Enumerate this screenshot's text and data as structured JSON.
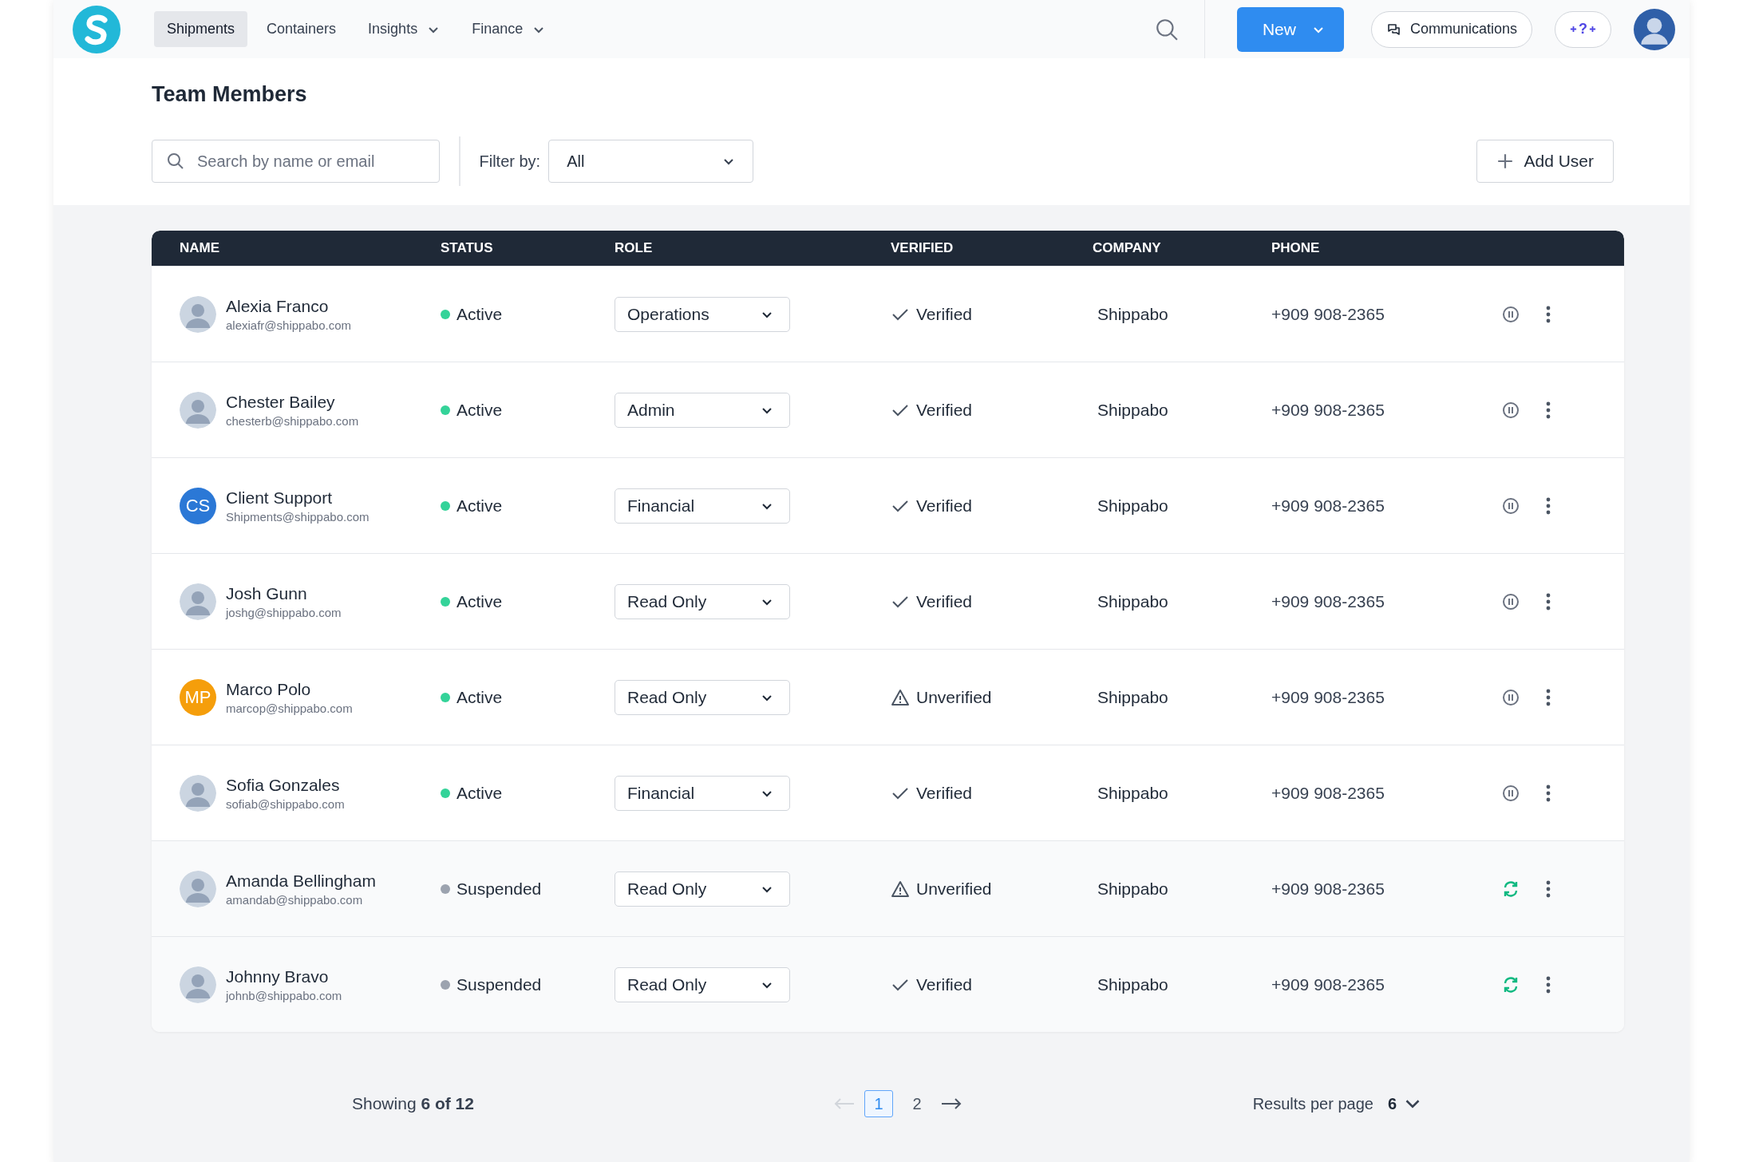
{
  "nav": {
    "tabs": [
      {
        "label": "Shipments",
        "selected": true,
        "has_menu": false
      },
      {
        "label": "Containers",
        "selected": false,
        "has_menu": false
      },
      {
        "label": "Insights",
        "selected": false,
        "has_menu": true
      },
      {
        "label": "Finance",
        "selected": false,
        "has_menu": true
      }
    ],
    "new_button": "New",
    "communications_button": "Communications",
    "help_button": "?"
  },
  "page": {
    "title": "Team Members",
    "search": {
      "placeholder": "Search by name or email"
    },
    "filter_label": "Filter by:",
    "filter_value": "All",
    "add_button": "Add User"
  },
  "table": {
    "columns": [
      "NAME",
      "STATUS",
      "ROLE",
      "VERIFIED",
      "COMPANY",
      "PHONE"
    ],
    "rows": [
      {
        "avatar": {
          "kind": "photo"
        },
        "name": "Alexia Franco",
        "email": "alexiafr@shippabo.com",
        "status": "Active",
        "suspended": false,
        "role": "Operations",
        "verified": true,
        "verification": "Verified",
        "company": "Shippabo",
        "phone": "+909 908-2365"
      },
      {
        "avatar": {
          "kind": "photo"
        },
        "name": "Chester Bailey",
        "email": "chesterb@shippabo.com",
        "status": "Active",
        "suspended": false,
        "role": "Admin",
        "verified": true,
        "verification": "Verified",
        "company": "Shippabo",
        "phone": "+909 908-2365"
      },
      {
        "avatar": {
          "kind": "initials",
          "text": "CS",
          "color": "#2b78d6"
        },
        "name": "Client Support",
        "email": "Shipments@shippabo.com",
        "status": "Active",
        "suspended": false,
        "role": "Financial",
        "verified": true,
        "verification": "Verified",
        "company": "Shippabo",
        "phone": "+909 908-2365"
      },
      {
        "avatar": {
          "kind": "photo"
        },
        "name": "Josh Gunn",
        "email": "joshg@shippabo.com",
        "status": "Active",
        "suspended": false,
        "role": "Read Only",
        "verified": true,
        "verification": "Verified",
        "company": "Shippabo",
        "phone": "+909 908-2365"
      },
      {
        "avatar": {
          "kind": "initials",
          "text": "MP",
          "color": "#f59e0b"
        },
        "name": "Marco Polo",
        "email": "marcop@shippabo.com",
        "status": "Active",
        "suspended": false,
        "role": "Read Only",
        "verified": false,
        "verification": "Unverified",
        "company": "Shippabo",
        "phone": "+909 908-2365"
      },
      {
        "avatar": {
          "kind": "photo"
        },
        "name": "Sofia Gonzales",
        "email": "sofiab@shippabo.com",
        "status": "Active",
        "suspended": false,
        "role": "Financial",
        "verified": true,
        "verification": "Verified",
        "company": "Shippabo",
        "phone": "+909 908-2365"
      },
      {
        "avatar": {
          "kind": "photo"
        },
        "name": "Amanda Bellingham",
        "email": "amandab@shippabo.com",
        "status": "Suspended",
        "suspended": true,
        "role": "Read Only",
        "verified": false,
        "verification": "Unverified",
        "company": "Shippabo",
        "phone": "+909 908-2365"
      },
      {
        "avatar": {
          "kind": "photo"
        },
        "name": "Johnny Bravo",
        "email": "johnb@shippabo.com",
        "status": "Suspended",
        "suspended": true,
        "role": "Read Only",
        "verified": true,
        "verification": "Verified",
        "company": "Shippabo",
        "phone": "+909 908-2365"
      }
    ]
  },
  "footer": {
    "showing": "Showing **6 of 12**",
    "pages": [
      {
        "label": "1",
        "selected": true
      },
      {
        "label": "2",
        "selected": false
      }
    ],
    "prev_disabled": true,
    "per_page_label": "Results per page",
    "per_page_value": "6"
  }
}
